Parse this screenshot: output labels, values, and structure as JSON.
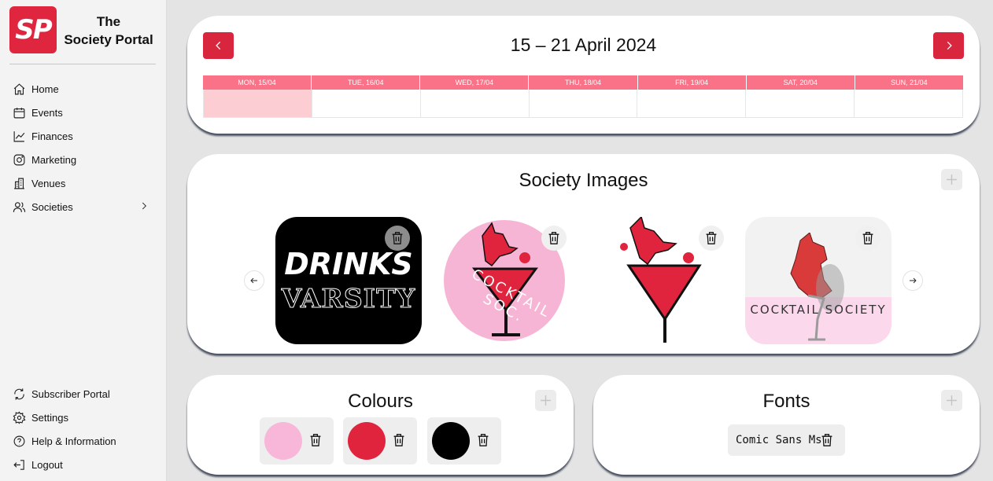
{
  "brand": {
    "logo_text": "SP",
    "name_line1": "The",
    "name_line2": "Society Portal"
  },
  "nav_top": [
    {
      "label": "Home",
      "icon": "home-icon"
    },
    {
      "label": "Events",
      "icon": "calendar-icon"
    },
    {
      "label": "Finances",
      "icon": "chart-icon"
    },
    {
      "label": "Marketing",
      "icon": "instagram-icon"
    },
    {
      "label": "Venues",
      "icon": "building-icon"
    },
    {
      "label": "Societies",
      "icon": "users-icon",
      "has_submenu": true
    }
  ],
  "nav_bottom": [
    {
      "label": "Subscriber Portal",
      "icon": "refresh-icon"
    },
    {
      "label": "Settings",
      "icon": "gear-icon"
    },
    {
      "label": "Help & Information",
      "icon": "help-icon"
    },
    {
      "label": "Logout",
      "icon": "logout-icon"
    }
  ],
  "week": {
    "title": "15 – 21 April 2024",
    "days": [
      "MON, 15/04",
      "TUE, 16/04",
      "WED, 17/04",
      "THU, 18/04",
      "FRI, 19/04",
      "SAT, 20/04",
      "SUN, 21/04"
    ],
    "highlighted_day": "MON, 15/04",
    "header_color": "#f97287",
    "highlight_color": "#fdcdd4"
  },
  "images": {
    "title": "Society Images",
    "items": [
      {
        "name": "drinks-varsity",
        "text_line1": "DRINKS",
        "text_line2": "VARSITY"
      },
      {
        "name": "cocktail-soc-circle",
        "text": "COCKTAIL SOC."
      },
      {
        "name": "cocktail-glass-fox"
      },
      {
        "name": "cocktail-society-banner",
        "text": "COCKTAIL SOCIETY"
      }
    ]
  },
  "colours": {
    "title": "Colours",
    "swatches": [
      "#f8b6d8",
      "#e0243e",
      "#000000"
    ]
  },
  "fonts": {
    "title": "Fonts",
    "items": [
      "Comic Sans Ms"
    ]
  },
  "accent": "#d8263f"
}
